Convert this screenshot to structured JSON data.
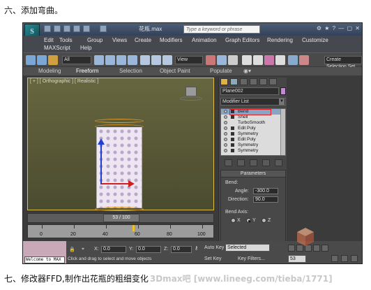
{
  "doc": {
    "heading_top": "六、添加弯曲。",
    "heading_bottom": "七、修改器FFD,制作出花瓶的粗细变化",
    "watermark": "3Dmax吧 [www.lineeg.com/tieba/1771]"
  },
  "app": {
    "logo_text": "S",
    "doc_title": "花瓶.max",
    "search_placeholder": "Type a keyword or phrase",
    "menus": [
      "Edit",
      "Tools",
      "Group",
      "Views",
      "Create",
      "Modifiers",
      "Animation",
      "Graph Editors",
      "Rendering",
      "Customize",
      "MAXScript",
      "Help"
    ],
    "toolbar_select_filter": "All",
    "toolbar_refcoord": "View",
    "toolbar_named_sel": "Create Selection Set",
    "ribbon_tabs": [
      "Modeling",
      "Freeform",
      "Selection",
      "Object Paint",
      "Populate"
    ],
    "ribbon_active": "Freeform"
  },
  "viewport": {
    "label": "[ + ] [ Orthographic ] [ Realistic ]"
  },
  "command_panel": {
    "object_name": "Plane002",
    "object_color": "#c28ad0",
    "modifier_list_label": "Modifier List",
    "stack": [
      "Bend",
      "Shell",
      "TurboSmooth",
      "Edit Poly",
      "Symmetry",
      "Edit Poly",
      "Symmetry",
      "Symmetry"
    ],
    "selected_index": 0,
    "params_title": "Parameters",
    "bend_group": "Bend:",
    "angle_label": "Angle:",
    "angle_value": "-300.0",
    "direction_label": "Direction:",
    "direction_value": "90.0",
    "bend_axis_label": "Bend Axis:",
    "axis_x": "X",
    "axis_y": "Y",
    "axis_z": "Z",
    "axis_selected": "Y"
  },
  "timeline": {
    "slider_label": "53 / 100",
    "ticks": [
      "0",
      "20",
      "40",
      "60",
      "80",
      "100"
    ],
    "current_frame": 53,
    "total_frames": 100
  },
  "status": {
    "welcome": "Welcome to MAX",
    "x_label": "X:",
    "y_label": "Y:",
    "z_label": "Z:",
    "x_value": "0.0",
    "y_value": "0.0",
    "z_value": "0.0",
    "prompt": "Click and drag to select and move objects",
    "auto_key": "Auto Key",
    "auto_key_value": "Selected",
    "set_key": "Set Key",
    "key_filters": "Key Filters...",
    "frame_value": "53"
  },
  "colors": {
    "accent_highlight": "#e02020",
    "ring": "#d48a1c",
    "axis_x": "#d02020",
    "axis_y": "#2040d0"
  }
}
